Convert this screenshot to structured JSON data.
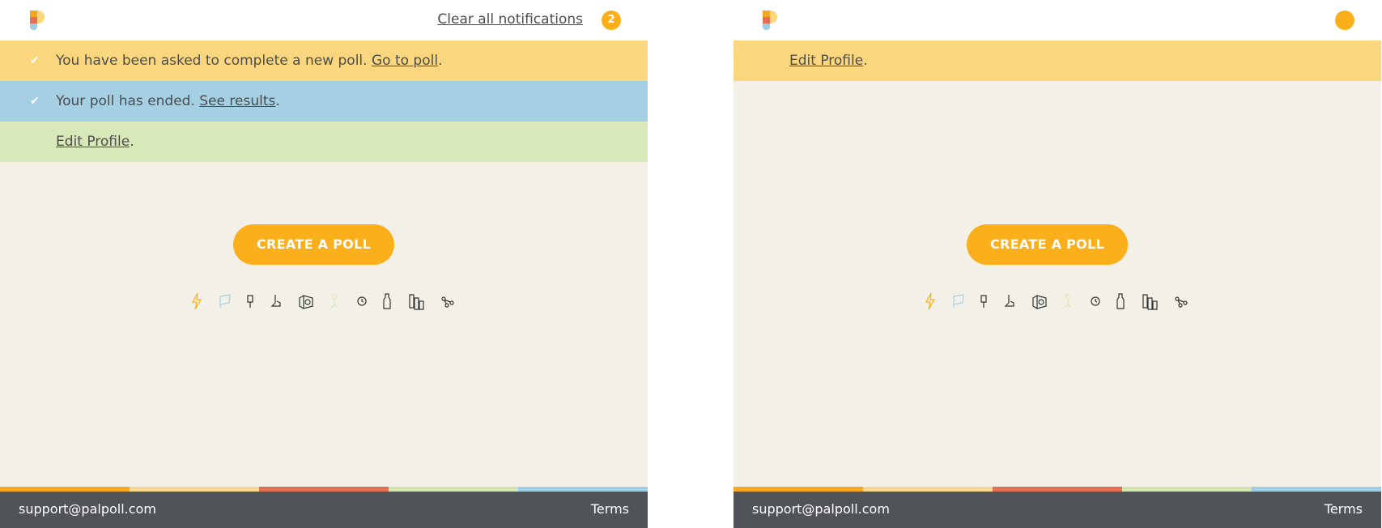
{
  "colors": {
    "accent": "#fbaf1b",
    "notice_yellow": "#fad77e",
    "notice_blue": "#a5cfe3",
    "notice_green": "#d9e8b8",
    "page_bg": "#f3f1e7",
    "footer_bg": "#505357",
    "stripe": [
      "#f6a722",
      "#f8d891",
      "#e26e55",
      "#d4e3b2",
      "#9ecde4"
    ]
  },
  "left_panel": {
    "header": {
      "clear_label": "Clear all notifications",
      "badge_count": "2"
    },
    "notifications": [
      {
        "color": "yellow",
        "icon": "check-icon",
        "text": "You have been asked to complete a new poll. ",
        "link": "Go to poll",
        "suffix": "."
      },
      {
        "color": "blue",
        "icon": "check-icon",
        "text": "Your poll has ended. ",
        "link": "See results",
        "suffix": "."
      },
      {
        "color": "green",
        "link": "Edit Profile",
        "suffix": "."
      }
    ],
    "cta_label": "CREATE A POLL",
    "footer": {
      "email": "support@palpoll.com",
      "terms": "Terms"
    }
  },
  "right_panel": {
    "notifications": [
      {
        "color": "yellow",
        "link": "Edit Profile",
        "suffix": "."
      }
    ],
    "cta_label": "CREATE A POLL",
    "footer": {
      "email": "support@palpoll.com",
      "terms": "Terms"
    }
  },
  "decor_icons": [
    "lightning-icon",
    "flag-icon",
    "pin-icon",
    "hand-icon",
    "camera-icon",
    "person-icon",
    "clock-icon",
    "bottle-icon",
    "buildings-icon",
    "share-icon"
  ]
}
